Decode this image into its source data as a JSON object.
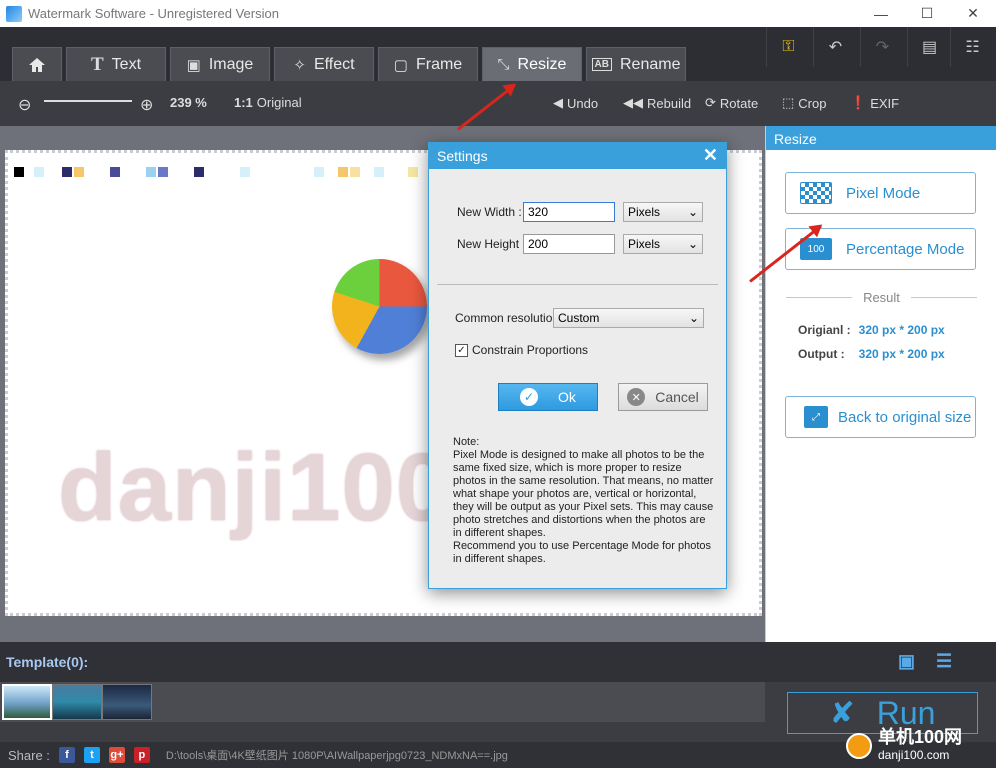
{
  "window": {
    "title": "Watermark Software - Unregistered Version",
    "minimize": "—",
    "maximize": "☐",
    "close": "✕"
  },
  "tabs": [
    {
      "label": "",
      "icon": "home-icon"
    },
    {
      "label": "Text",
      "icon": "T"
    },
    {
      "label": "Image",
      "icon": "image-icon"
    },
    {
      "label": "Effect",
      "icon": "wand-icon"
    },
    {
      "label": "Frame",
      "icon": "frame-icon"
    },
    {
      "label": "Resize",
      "icon": "resize-icon"
    },
    {
      "label": "Rename",
      "icon": "AB"
    }
  ],
  "right_toolbar": [
    "key-icon",
    "undo-icon",
    "redo-icon",
    "message-icon",
    "list-icon"
  ],
  "subbar": {
    "zoom": "239 %",
    "original_prefix": "1:1",
    "original": "Original",
    "undo": "Undo",
    "rebuild": "Rebuild",
    "rotate": "Rotate",
    "crop": "Crop",
    "exif": "EXIF"
  },
  "canvas": {
    "watermark_text": "danji100"
  },
  "resize_panel": {
    "header": "Resize",
    "pixel_mode": "Pixel Mode",
    "percentage_mode": "Percentage Mode",
    "result_label": "Result",
    "original_label": "Origianl :",
    "original_value": "320 px * 200 px",
    "output_label": "Output :",
    "output_value": "320 px * 200 px",
    "back_label": "Back to original size"
  },
  "dialog": {
    "title": "Settings",
    "new_width_label": "New Width :",
    "new_width_value": "320",
    "new_height_label": "New Height :",
    "new_height_value": "200",
    "unit1": "Pixels",
    "unit2": "Pixels",
    "common_res_label": "Common resolution :",
    "common_res_value": "Custom",
    "constrain_label": "Constrain Proportions",
    "constrain_checked": true,
    "ok": "Ok",
    "cancel": "Cancel",
    "note": "Note:\nPixel Mode is designed to make all photos to be the same fixed size, which is more proper to resize photos in the same resolution. That means, no matter what shape your photos are, vertical or horizontal, they will be output as your Pixel sets. This may cause photo stretches and distortions when the photos are in different shapes.\nRecommend you to use Percentage Mode for photos in different shapes."
  },
  "template": {
    "label": "Template(0):"
  },
  "run": {
    "label": "Run"
  },
  "share": {
    "label": "Share :",
    "networks": [
      "f",
      "t",
      "g+",
      "p"
    ],
    "path": "D:\\tools\\桌面\\4K壁纸图片 1080P\\AIWallpaperjpg0723_NDMxNA==.jpg"
  },
  "site_badge": {
    "text": "单机100网",
    "sub": "danji100.com"
  },
  "colors": {
    "accent": "#3aa0db",
    "arrow": "#d9261c"
  }
}
